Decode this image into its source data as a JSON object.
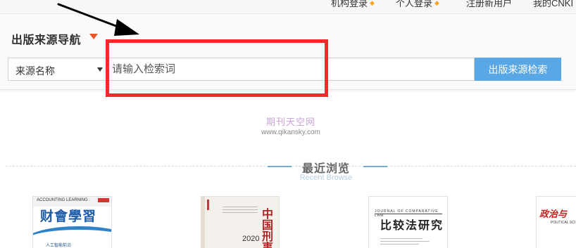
{
  "topbar": {
    "institution_login": "机构登录",
    "personal_login": "个人登录",
    "register": "注册新用户",
    "my_cnki": "我的CNKI"
  },
  "nav": {
    "title": "出版来源导航"
  },
  "search": {
    "select_value": "来源名称",
    "placeholder": "请输入检索词",
    "button_label": "出版来源检索"
  },
  "watermark": {
    "name": "期刊天空网",
    "url": "www.qikansky.com"
  },
  "recent": {
    "title": "最近浏览",
    "subtitle": "Recent Browse",
    "covers": [
      {
        "label_en": "ACCOUNTING LEARNING",
        "title": "财會學習",
        "sub": "人工智能前沿"
      },
      {
        "title": "中国刑事",
        "year": "2020"
      },
      {
        "label_en": "JOURNAL OF COMPARATIVE LAW",
        "title": "比较法研究"
      },
      {
        "title": "政治与",
        "label_en": "POLITICAL SCI"
      }
    ]
  },
  "colors": {
    "accent_blue": "#5aa7e6",
    "nav_caret": "#e8572c",
    "highlight_red": "#ef2b2b",
    "topbar_caret": "#f5a623"
  },
  "icons": {
    "topbar_caret": "chevron-down-icon",
    "select_arrow": "caret-down-icon",
    "nav_caret": "triangle-down-icon",
    "annotation": "arrow-icon"
  }
}
